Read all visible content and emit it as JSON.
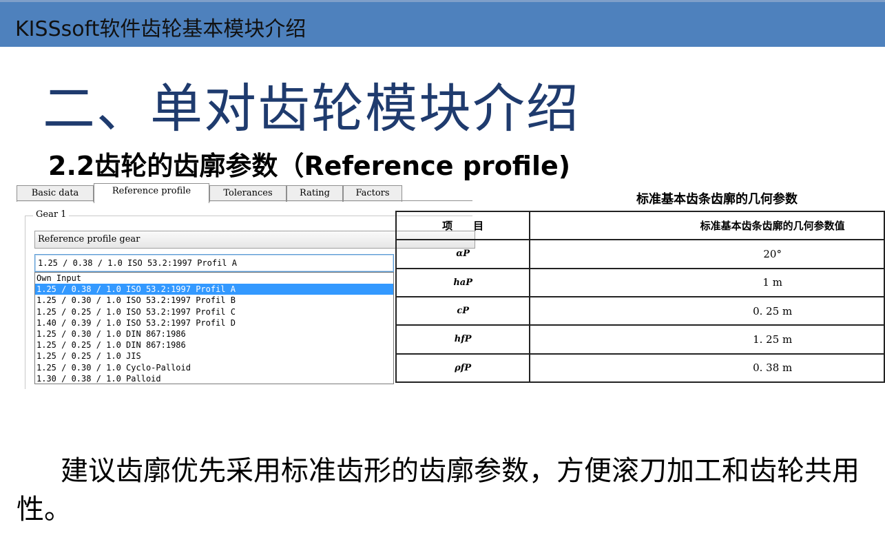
{
  "header": {
    "title": "KISSsoft软件齿轮基本模块介绍"
  },
  "slide": {
    "title": "二、单对齿轮模块介绍",
    "subtitle": "2.2齿轮的齿廓参数（Reference profile)"
  },
  "software": {
    "tabs": [
      "Basic data",
      "Reference profile",
      "Tolerances",
      "Rating",
      "Factors"
    ],
    "active_tab": "Reference profile",
    "group_label": "Gear 1",
    "combo_label": "Reference profile gear",
    "selected_value": "1.25 / 0.38 / 1.0 ISO 53.2:1997 Profil A",
    "options": [
      "Own Input",
      "1.25 / 0.38 / 1.0 ISO 53.2:1997 Profil A",
      "1.25 / 0.30 / 1.0 ISO 53.2:1997 Profil B",
      "1.25 / 0.25 / 1.0 ISO 53.2:1997 Profil C",
      "1.40 / 0.39 / 1.0 ISO 53.2:1997 Profil D",
      "1.25 / 0.30 / 1.0 DIN 867:1986",
      "1.25 / 0.25 / 1.0 DIN 867:1986",
      "1.25 / 0.25 / 1.0 JIS",
      "1.25 / 0.30 / 1.0 Cyclo-Palloid",
      "1.30 / 0.38 / 1.0 Palloid"
    ],
    "highlighted_option_index": 1
  },
  "table": {
    "title": "标准基本齿条齿廓的几何参数",
    "headers": [
      "项　　目",
      "标准基本齿条齿廓的几何参数值"
    ],
    "rows": [
      [
        "αP",
        "20°"
      ],
      [
        "haP",
        "1 m"
      ],
      [
        "cP",
        "0. 25 m"
      ],
      [
        "hfP",
        "1. 25 m"
      ],
      [
        "ρfP",
        "0. 38 m"
      ]
    ]
  },
  "paragraph": {
    "text": "建议齿廓优先采用标准齿形的齿廓参数，方便滚刀加工和齿轮共用性。"
  }
}
